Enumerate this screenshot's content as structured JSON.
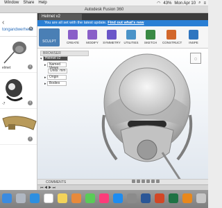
{
  "menubar": {
    "items": [
      "Window",
      "Share",
      "Help"
    ],
    "battery": "43%",
    "clock": "Mon Apr 10"
  },
  "window": {
    "title": "Autodesk Fusion 360"
  },
  "data_panel": {
    "folder": "tongandwerheed",
    "items": [
      {
        "caption": "elmet"
      },
      {
        "caption": "-7"
      },
      {
        "caption": ""
      }
    ]
  },
  "tab": {
    "label": "Helmet v2"
  },
  "banner": {
    "text": "You are all set with the latest update.",
    "link": "Find out what's new"
  },
  "toolbar": {
    "workspace": "SCULPT",
    "buttons": [
      {
        "label": "CREATE",
        "color": "#8a5fc8"
      },
      {
        "label": "MODIFY",
        "color": "#8a5fc8"
      },
      {
        "label": "SYMMETRY",
        "color": "#6a56c8"
      },
      {
        "label": "UTILITIES",
        "color": "#4a93c8"
      },
      {
        "label": "SKETCH",
        "color": "#3a8a44"
      },
      {
        "label": "CONSTRUCT",
        "color": "#d2672b"
      },
      {
        "label": "INSPE",
        "color": "#2f76c0"
      }
    ]
  },
  "browser": {
    "header": "BROWSER",
    "root": "Helmet v2",
    "rows": [
      "Named Views",
      "Units: mm",
      "Origin",
      "Bodies"
    ]
  },
  "comments": {
    "label": "COMMENTS"
  },
  "dock": {
    "apps": [
      {
        "name": "finder",
        "color": "#3b8be0"
      },
      {
        "name": "launchpad",
        "color": "#b0b7c2"
      },
      {
        "name": "safari",
        "color": "#2d8fe0"
      },
      {
        "name": "calendar",
        "color": "#ffffff"
      },
      {
        "name": "notes",
        "color": "#f3d35a"
      },
      {
        "name": "photos",
        "color": "#e88a3b"
      },
      {
        "name": "messages",
        "color": "#5acb57"
      },
      {
        "name": "music",
        "color": "#fc3c7a"
      },
      {
        "name": "appstore",
        "color": "#1e8cf0"
      },
      {
        "name": "settings",
        "color": "#8b8b8b"
      },
      {
        "name": "word",
        "color": "#2b5797"
      },
      {
        "name": "powerpoint",
        "color": "#d24726"
      },
      {
        "name": "excel",
        "color": "#1f7244"
      },
      {
        "name": "fusion",
        "color": "#e8881c"
      },
      {
        "name": "trash",
        "color": "#c7c7c7"
      }
    ]
  }
}
